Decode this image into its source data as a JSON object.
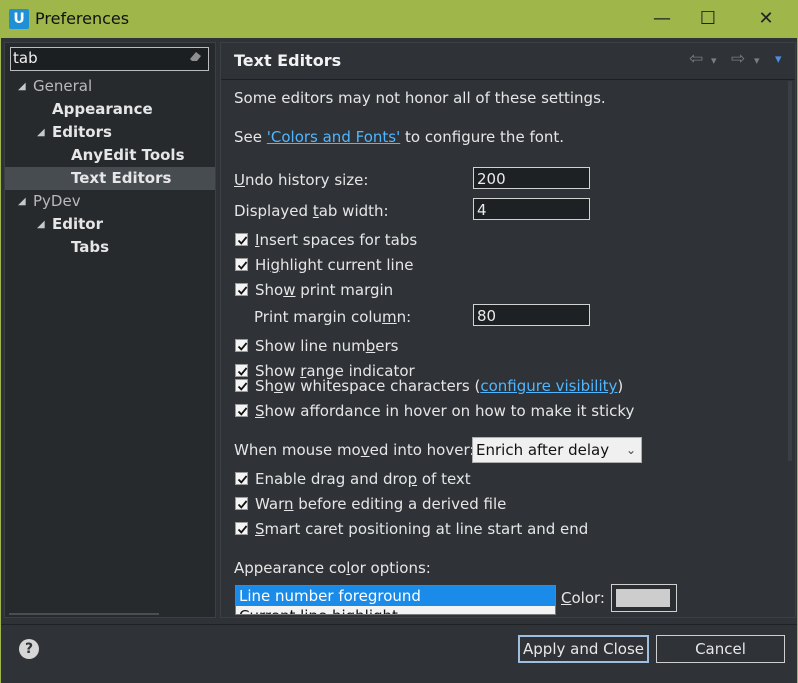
{
  "window": {
    "app_icon": "U",
    "title": "Preferences",
    "controls": {
      "minimize": "—",
      "maximize": "☐",
      "close": "✕"
    }
  },
  "left": {
    "filter_value": "tab",
    "clear_icon": "eraser-icon",
    "tree": [
      {
        "label": "General",
        "level": 0,
        "expanded": true,
        "bold": false
      },
      {
        "label": "Appearance",
        "level": 1,
        "bold": true
      },
      {
        "label": "Editors",
        "level": 1,
        "expanded": true,
        "bold": true
      },
      {
        "label": "AnyEdit Tools",
        "level": 2,
        "bold": true
      },
      {
        "label": "Text Editors",
        "level": 2,
        "bold": true,
        "selected": true
      },
      {
        "label": "PyDev",
        "level": 0,
        "expanded": true,
        "bold": false
      },
      {
        "label": "Editor",
        "level": 1,
        "expanded": true,
        "bold": true
      },
      {
        "label": "Tabs",
        "level": 2,
        "bold": true
      }
    ]
  },
  "page": {
    "title": "Text Editors",
    "nav": {
      "back": "⇦",
      "forward": "⇨",
      "menu": "▾"
    },
    "note": "Some editors may not honor all of these settings.",
    "see_prefix": "See ",
    "see_link": "'Colors and Fonts'",
    "see_suffix": " to configure the font.",
    "undo": {
      "label_pre": "",
      "label_u": "U",
      "label_post": "ndo history size:",
      "value": "200"
    },
    "tabwidth": {
      "label_pre": "Displayed ",
      "label_u": "t",
      "label_post": "ab width:",
      "value": "4"
    },
    "checks": [
      {
        "pre": "",
        "u": "I",
        "post": "nsert spaces for tabs",
        "checked": true
      },
      {
        "pre": "Hi",
        "u": "g",
        "post": "hlight current line",
        "checked": true
      },
      {
        "pre": "Sho",
        "u": "w",
        "post": " print margin",
        "checked": true
      }
    ],
    "margin": {
      "label_pre": "Print margin colu",
      "label_u": "m",
      "label_post": "n:",
      "value": "80"
    },
    "checks2": [
      {
        "pre": "Show line num",
        "u": "b",
        "post": "ers",
        "checked": true
      },
      {
        "pre": "Show ",
        "u": "r",
        "post": "ange indicator",
        "checked": true
      }
    ],
    "whitespace": {
      "pre": "Sh",
      "u": "o",
      "post": "w whitespace characters (",
      "link": "configure visibility",
      "tail": ")",
      "checked": true
    },
    "affordance": {
      "pre": "",
      "u": "S",
      "post": "how affordance in hover on how to make it sticky",
      "checked": true
    },
    "hover": {
      "label_pre": "When mouse mo",
      "label_u": "v",
      "label_post": "ed into hover:",
      "selected": "Enrich after delay"
    },
    "checks3": [
      {
        "pre": "Enable drag and dro",
        "u": "p",
        "post": " of text",
        "checked": true
      },
      {
        "pre": "War",
        "u": "n",
        "post": " before editing a derived file",
        "checked": true
      },
      {
        "pre": "",
        "u": "S",
        "post": "mart caret positioning at line start and end",
        "checked": true
      }
    ],
    "appearance": {
      "label_pre": "Appearance co",
      "label_u": "l",
      "label_post": "or options:",
      "items": [
        "Line number foreground",
        "Current line highlight"
      ],
      "color_label_pre": "",
      "color_label_u": "C",
      "color_label_post": "olor:"
    }
  },
  "footer": {
    "help_icon": "help-icon",
    "apply_close": "Apply and Close",
    "cancel": "Cancel"
  }
}
